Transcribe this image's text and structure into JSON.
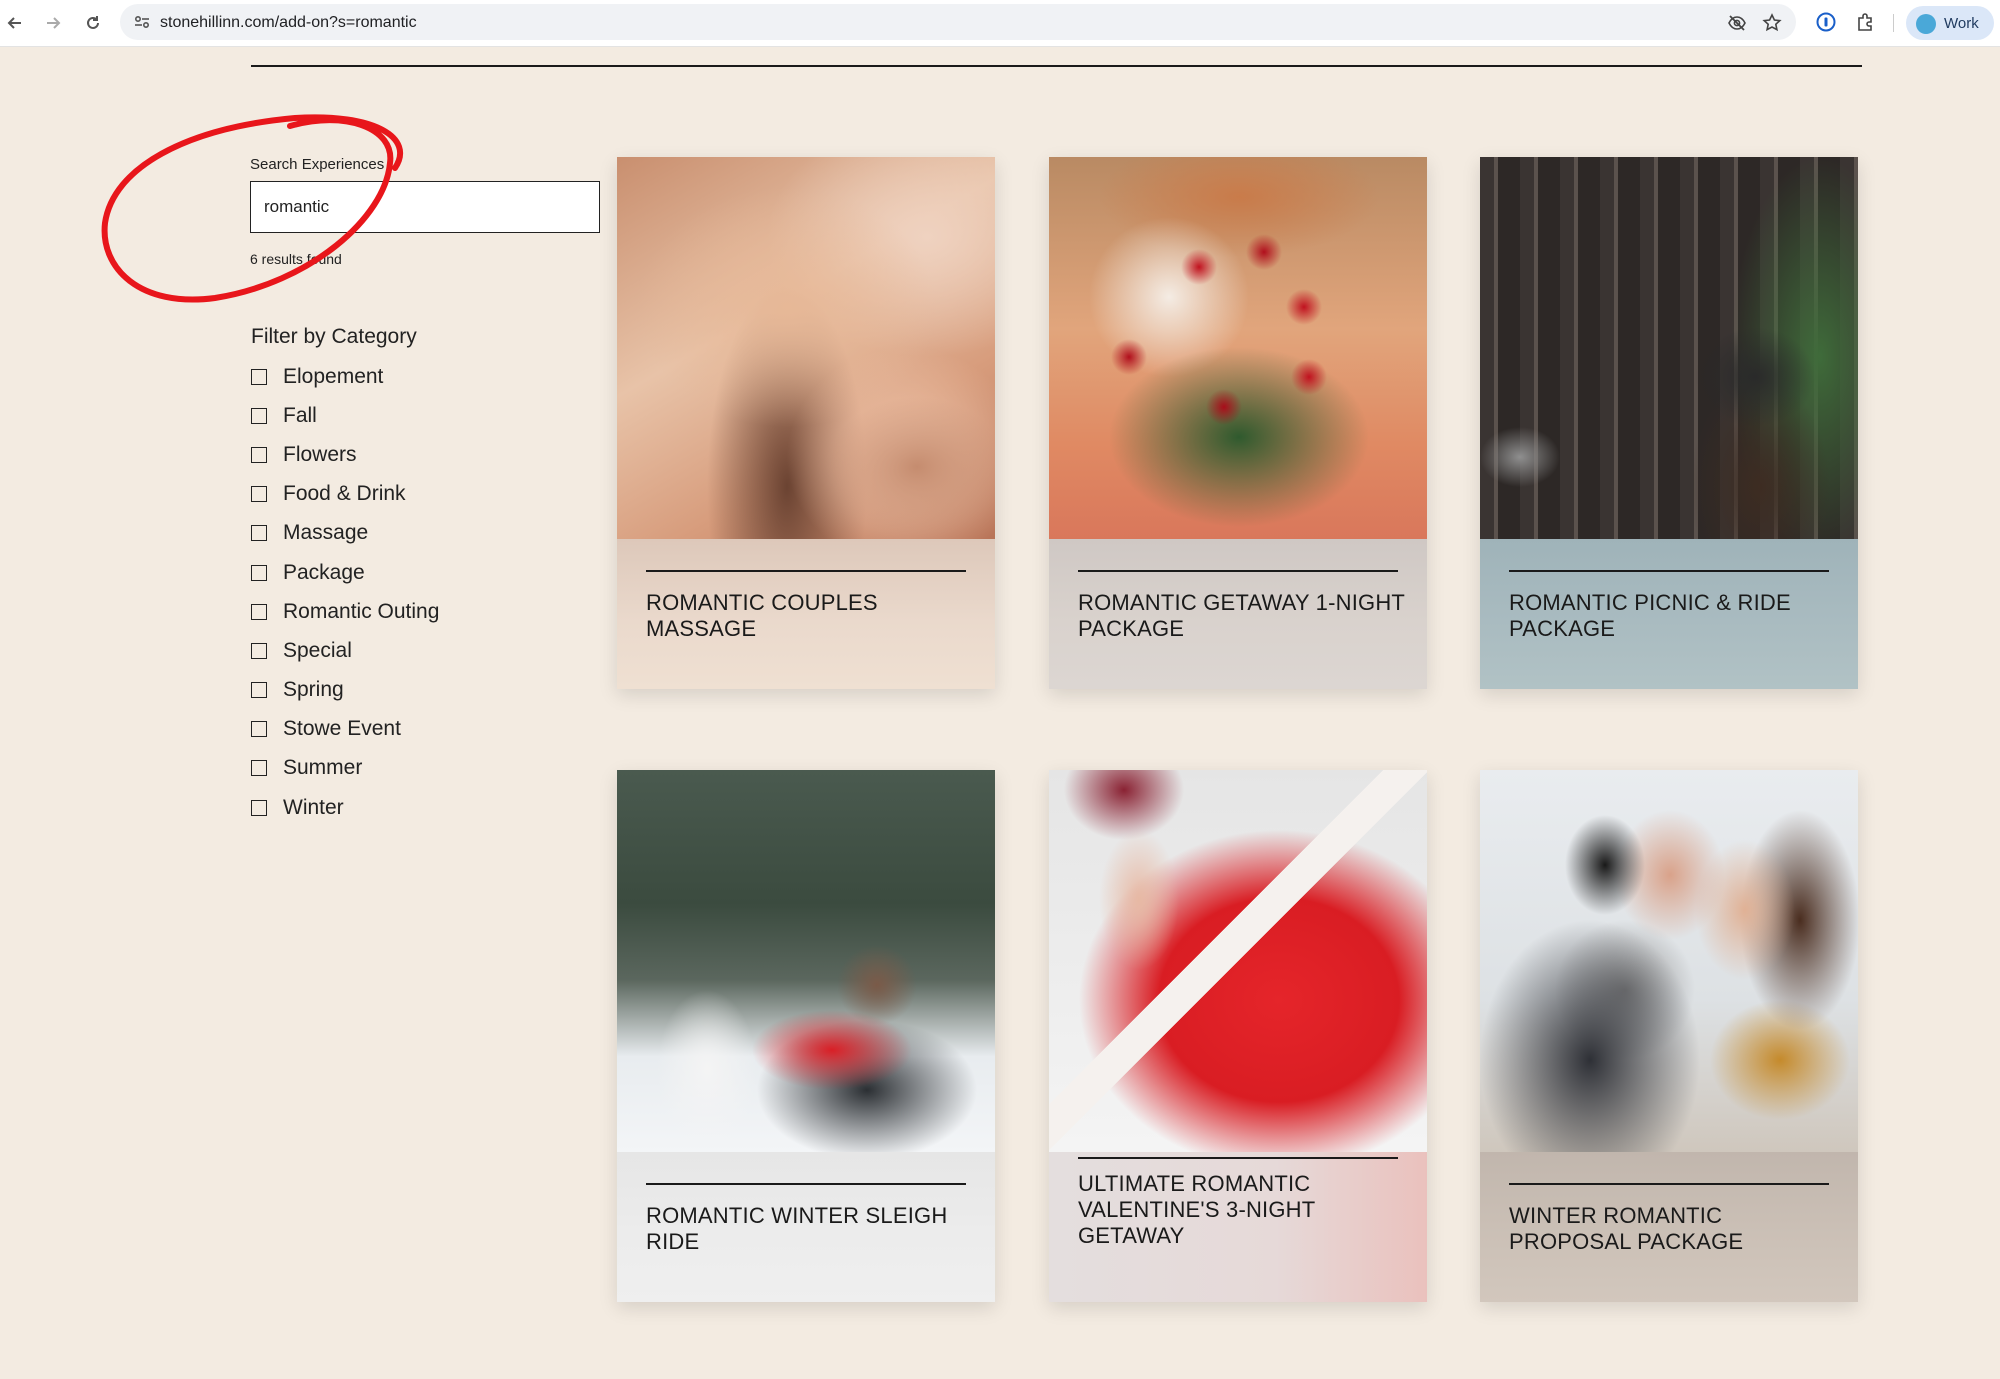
{
  "browser": {
    "url": "stonehillinn.com/add-on?s=romantic",
    "profile_label": "Work"
  },
  "search": {
    "label": "Search Experiences",
    "value": "romantic",
    "results_text": "6 results found"
  },
  "filter": {
    "title": "Filter by Category",
    "categories": [
      "Elopement",
      "Fall",
      "Flowers",
      "Food & Drink",
      "Massage",
      "Package",
      "Romantic Outing",
      "Special",
      "Spring",
      "Stowe Event",
      "Summer",
      "Winter"
    ]
  },
  "cards": [
    {
      "title": "ROMANTIC COUPLES MASSAGE"
    },
    {
      "title": "ROMANTIC GETAWAY 1-NIGHT PACKAGE"
    },
    {
      "title": "ROMANTIC PICNIC & RIDE PACKAGE"
    },
    {
      "title": "ROMANTIC WINTER SLEIGH RIDE"
    },
    {
      "title": "ULTIMATE ROMANTIC VALENTINE'S 3-NIGHT GETAWAY"
    },
    {
      "title": "WINTER ROMANTIC PROPOSAL PACKAGE"
    }
  ],
  "colors": {
    "page_background": "#f3ebe1",
    "annotation_circle": "#e8161b"
  }
}
